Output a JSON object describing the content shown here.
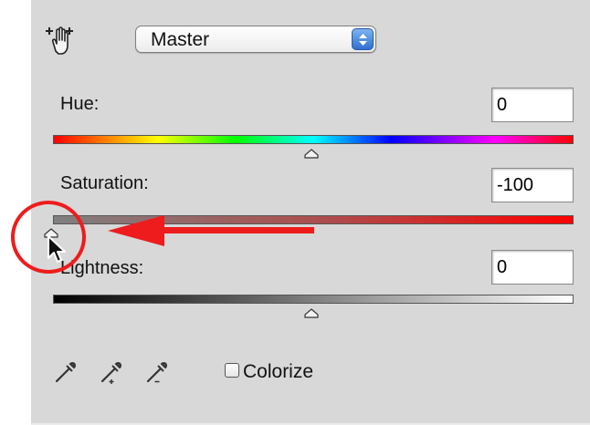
{
  "preset": {
    "selected": "Master"
  },
  "hue": {
    "label": "Hue:",
    "value": "0",
    "slider_position": 0.5
  },
  "saturation": {
    "label": "Saturation:",
    "value": "-100",
    "slider_position": 0.0
  },
  "lightness": {
    "label": "Lightness:",
    "value": "0",
    "slider_position": 0.5
  },
  "tools": [
    "eyedropper-icon",
    "eyedropper-plus-icon",
    "eyedropper-minus-icon"
  ],
  "colorize": {
    "label": "Colorize",
    "checked": false
  },
  "annotation": {
    "color": "#ee1c1c"
  }
}
